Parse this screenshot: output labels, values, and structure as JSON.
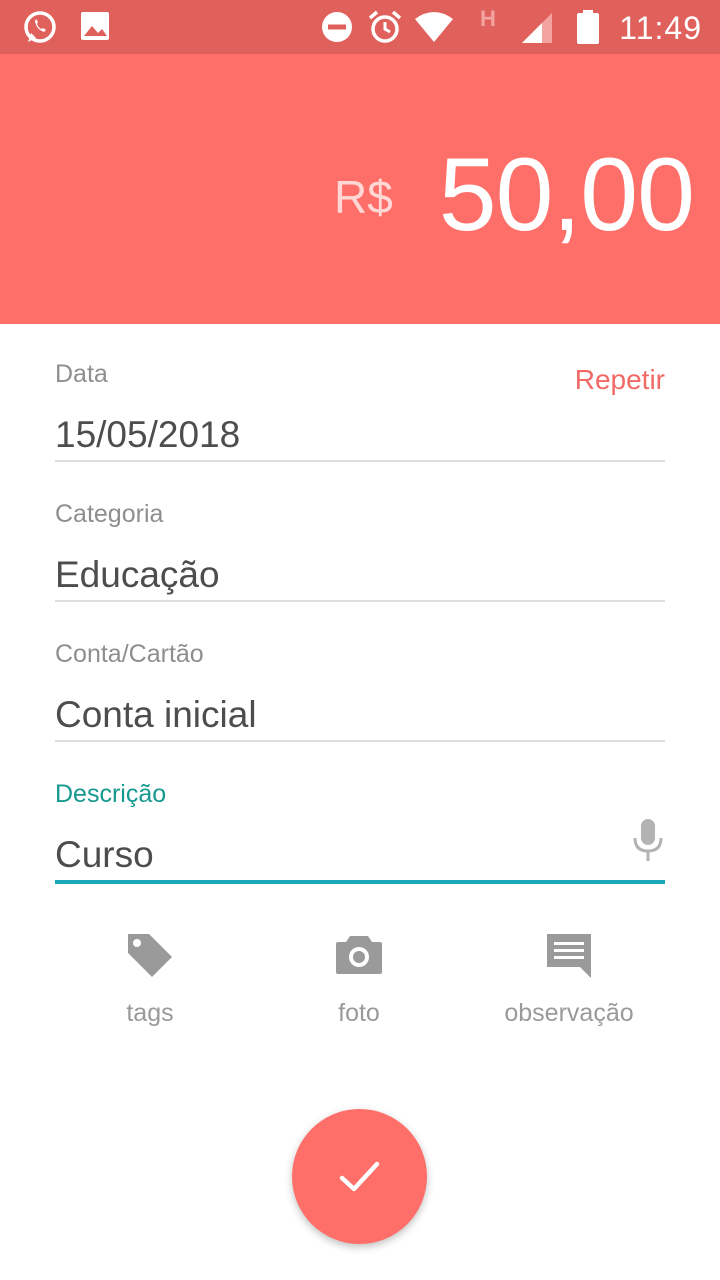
{
  "status_bar": {
    "time": "11:49",
    "network_letter": "H",
    "icons": [
      "whatsapp-icon",
      "image-icon",
      "dnd-icon",
      "alarm-icon",
      "wifi-icon",
      "signal-icon",
      "battery-icon"
    ]
  },
  "header": {
    "currency": "R$",
    "amount": "50,00",
    "background": "#ff6f69"
  },
  "form": {
    "date": {
      "label": "Data",
      "value": "15/05/2018",
      "repeat_label": "Repetir"
    },
    "category": {
      "label": "Categoria",
      "value": "Educação"
    },
    "account": {
      "label": "Conta/Cartão",
      "value": "Conta inicial"
    },
    "description": {
      "label": "Descrição",
      "value": "Curso"
    }
  },
  "actions": {
    "tags": "tags",
    "photo": "foto",
    "note": "observação"
  },
  "colors": {
    "accent": "#ff6f69",
    "active_label": "#16998f",
    "active_line": "#1aa8bd"
  }
}
